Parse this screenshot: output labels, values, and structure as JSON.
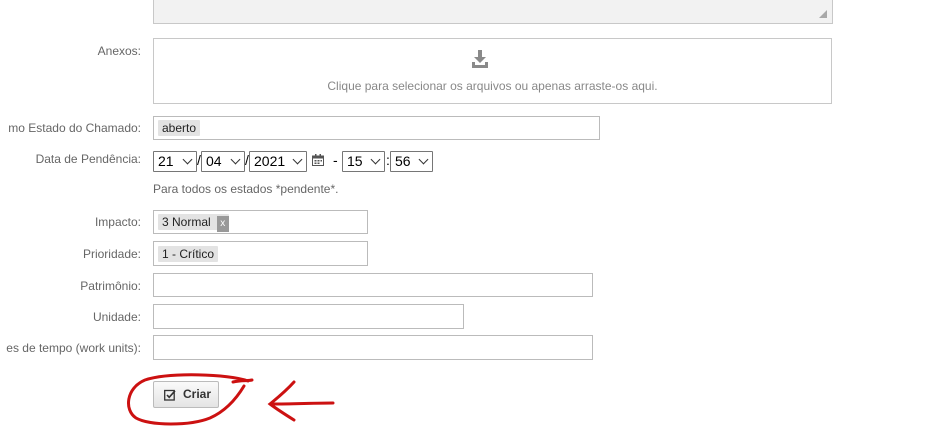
{
  "form": {
    "attachments": {
      "label": "Anexos:",
      "dropzone_text": "Clique para selecionar os arquivos ou apenas arraste-os aqui.",
      "icon": "download-tray-icon"
    },
    "next_state": {
      "label": "mo Estado do Chamado:",
      "value": "aberto"
    },
    "pending_date": {
      "label": "Data de Pendência:",
      "day": "21",
      "month": "04",
      "year": "2021",
      "separator": "/",
      "dash": "-",
      "colon": ":",
      "hour": "15",
      "minute": "56",
      "hint": "Para todos os estados *pendente*."
    },
    "impact": {
      "label": "Impacto:",
      "value": "3 Normal",
      "remove": "x"
    },
    "priority": {
      "label": "Prioridade:",
      "value": "1 - Crítico"
    },
    "asset": {
      "label": "Patrimônio:",
      "value": ""
    },
    "unit": {
      "label": "Unidade:",
      "value": ""
    },
    "work_units": {
      "label": "es de tempo (work units):",
      "value": ""
    },
    "submit": {
      "label": "Criar",
      "icon": "check-square-icon"
    }
  },
  "annotation": {
    "color": "#cc1111"
  }
}
